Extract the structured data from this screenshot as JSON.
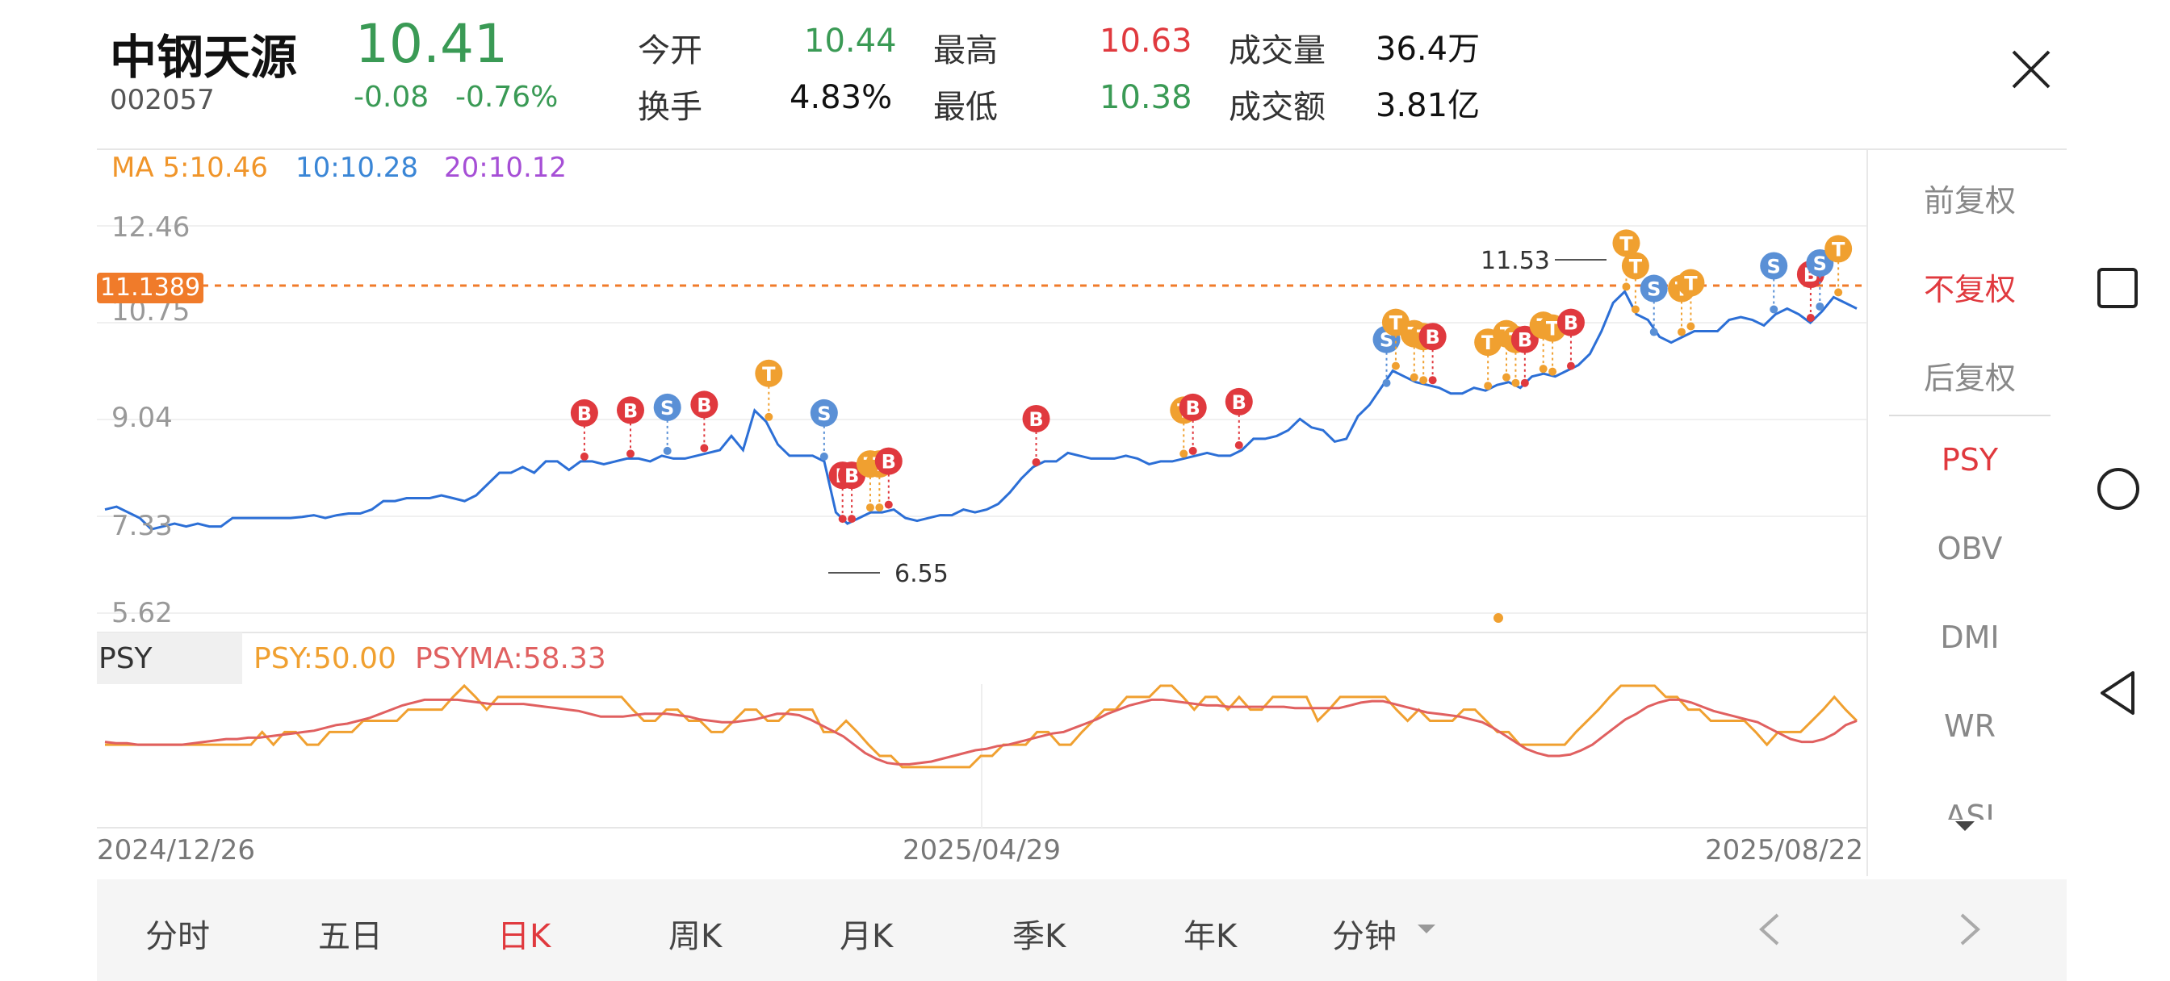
{
  "header": {
    "stock_name": "中钢天源",
    "stock_code": "002057",
    "last_price": "10.41",
    "change": "-0.08",
    "change_pct": "-0.76%",
    "quotes": [
      {
        "label": "今开",
        "value": "10.44",
        "color": "green"
      },
      {
        "label": "最高",
        "value": "10.63",
        "color": "red"
      },
      {
        "label": "成交量",
        "value": "36.4万",
        "color": "dark"
      },
      {
        "label": "换手",
        "value": "4.83%",
        "color": "dark"
      },
      {
        "label": "最低",
        "value": "10.38",
        "color": "green"
      },
      {
        "label": "成交额",
        "value": "3.81亿",
        "color": "dark"
      }
    ]
  },
  "ma_legend": {
    "ma5": "MA 5:10.46",
    "ma10": "10:10.28",
    "ma20": "20:10.12",
    "colors": {
      "ma5": "#f0952a",
      "ma10": "#3a86d6",
      "ma20": "#a64fd6"
    }
  },
  "main_chart": {
    "y_labels": [
      "12.46",
      "10.75",
      "9.04",
      "7.33",
      "5.62"
    ],
    "current_price_tag": "11.1389",
    "high_annotation": "11.53",
    "low_annotation": "6.55",
    "line_color": "#2c6fd6",
    "ref_line_color": "#f07b2a"
  },
  "chart_data": [
    {
      "type": "line",
      "title": "",
      "x": [
        "2024/12/26",
        "2025/04/29",
        "2025/08/22"
      ],
      "series": [
        {
          "name": "",
          "values": [
            7.45,
            7.5,
            7.4,
            7.3,
            7.1,
            7.15,
            7.2,
            7.15,
            7.2,
            7.15,
            7.15,
            7.3,
            7.3,
            7.3,
            7.3,
            7.3,
            7.3,
            7.32,
            7.35,
            7.3,
            7.35,
            7.38,
            7.38,
            7.45,
            7.6,
            7.6,
            7.65,
            7.65,
            7.65,
            7.7,
            7.65,
            7.6,
            7.7,
            7.9,
            8.1,
            8.1,
            8.2,
            8.1,
            8.3,
            8.3,
            8.15,
            8.3,
            8.3,
            8.25,
            8.3,
            8.35,
            8.35,
            8.3,
            8.4,
            8.35,
            8.35,
            8.4,
            8.45,
            8.5,
            8.75,
            8.5,
            9.2,
            9.0,
            8.6,
            8.4,
            8.4,
            8.4,
            8.3,
            7.4,
            7.2,
            7.3,
            7.4,
            7.4,
            7.45,
            7.3,
            7.25,
            7.3,
            7.35,
            7.35,
            7.45,
            7.4,
            7.45,
            7.55,
            7.75,
            8.0,
            8.2,
            8.3,
            8.3,
            8.45,
            8.4,
            8.35,
            8.35,
            8.35,
            8.4,
            8.35,
            8.25,
            8.3,
            8.3,
            8.35,
            8.4,
            8.45,
            8.4,
            8.4,
            8.5,
            8.7,
            8.7,
            8.75,
            8.85,
            9.05,
            8.9,
            8.85,
            8.65,
            8.7,
            9.1,
            9.3,
            9.6,
            9.9,
            9.8,
            9.7,
            9.65,
            9.6,
            9.5,
            9.5,
            9.6,
            9.55,
            9.65,
            9.7,
            9.6,
            9.8,
            9.85,
            9.8,
            9.9,
            10.0,
            10.2,
            10.6,
            11.1,
            11.3,
            10.9,
            10.8,
            10.5,
            10.4,
            10.5,
            10.6,
            10.6,
            10.6,
            10.8,
            10.85,
            10.8,
            10.7,
            10.9,
            11.0,
            10.9,
            10.75,
            10.95,
            11.2,
            11.1,
            11.0
          ]
        }
      ]
    },
    {
      "type": "line",
      "title": "",
      "series": [
        {
          "name": "PSY",
          "values": [
            58,
            58,
            58,
            58,
            58,
            58,
            58,
            58,
            58,
            58,
            58,
            58,
            58,
            58,
            67,
            58,
            67,
            67,
            58,
            58,
            67,
            67,
            67,
            75,
            75,
            75,
            75,
            83,
            83,
            83,
            83,
            92,
            100,
            92,
            83,
            92,
            92,
            92,
            92,
            92,
            92,
            92,
            92,
            92,
            92,
            92,
            92,
            83,
            75,
            75,
            83,
            83,
            75,
            75,
            67,
            67,
            75,
            83,
            83,
            75,
            75,
            83,
            83,
            83,
            67,
            67,
            75,
            67,
            58,
            50,
            50,
            42,
            42,
            42,
            42,
            42,
            42,
            42,
            50,
            50,
            58,
            58,
            58,
            67,
            67,
            58,
            58,
            67,
            75,
            83,
            83,
            92,
            92,
            92,
            100,
            100,
            92,
            83,
            92,
            92,
            83,
            92,
            83,
            83,
            92,
            92,
            92,
            92,
            75,
            83,
            92,
            92,
            92,
            92,
            92,
            83,
            75,
            83,
            75,
            75,
            75,
            83,
            83,
            75,
            67,
            67,
            58,
            58,
            58,
            58,
            58,
            67,
            75,
            83,
            92,
            100,
            100,
            100,
            100,
            92,
            92,
            83,
            83,
            75,
            75,
            75,
            75,
            67,
            58,
            67,
            67,
            67,
            75,
            83,
            92,
            83,
            75
          ]
        },
        {
          "name": "PSYMA",
          "values": [
            60,
            59,
            59,
            58,
            58,
            58,
            58,
            58,
            59,
            60,
            61,
            62,
            62,
            63,
            63,
            64,
            65,
            66,
            67,
            68,
            70,
            72,
            73,
            75,
            77,
            80,
            83,
            86,
            88,
            90,
            90,
            90,
            90,
            89,
            88,
            87,
            87,
            87,
            87,
            86,
            85,
            84,
            83,
            82,
            80,
            78,
            78,
            78,
            79,
            80,
            80,
            80,
            79,
            78,
            76,
            75,
            74,
            74,
            75,
            76,
            78,
            80,
            80,
            79,
            76,
            72,
            68,
            64,
            58,
            52,
            48,
            45,
            44,
            44,
            45,
            46,
            48,
            50,
            52,
            54,
            55,
            57,
            58,
            60,
            62,
            64,
            66,
            67,
            70,
            73,
            76,
            80,
            83,
            86,
            88,
            90,
            90,
            89,
            88,
            87,
            86,
            86,
            85,
            85,
            85,
            85,
            85,
            85,
            84,
            84,
            84,
            84,
            84,
            86,
            88,
            89,
            89,
            87,
            85,
            83,
            81,
            80,
            79,
            78,
            76,
            74,
            70,
            65,
            60,
            55,
            52,
            50,
            50,
            51,
            54,
            58,
            64,
            70,
            76,
            80,
            85,
            88,
            90,
            90,
            88,
            85,
            82,
            80,
            78,
            76,
            74,
            70,
            66,
            62,
            60,
            60,
            62,
            66,
            72,
            75
          ]
        }
      ],
      "ylim": [
        0,
        100
      ]
    }
  ],
  "psy": {
    "label": "PSY",
    "psy_value": "PSY:50.00",
    "psyma_value": "PSYMA:58.33",
    "psy_color": "#f0a030",
    "psyma_color": "#e06060"
  },
  "dates": [
    "2024/12/26",
    "2025/04/29",
    "2025/08/22"
  ],
  "side_menu": [
    {
      "label": "前复权",
      "active": false
    },
    {
      "label": "不复权",
      "active": true
    },
    {
      "label": "后复权",
      "active": false
    },
    {
      "label": "PSY",
      "active": true
    },
    {
      "label": "OBV",
      "active": false
    },
    {
      "label": "DMI",
      "active": false
    },
    {
      "label": "WR",
      "active": false
    },
    {
      "label": "ASI",
      "active": false
    }
  ],
  "tabs": [
    {
      "label": "分时"
    },
    {
      "label": "五日"
    },
    {
      "label": "日K"
    },
    {
      "label": "周K"
    },
    {
      "label": "月K"
    },
    {
      "label": "季K"
    },
    {
      "label": "年K"
    },
    {
      "label": "分钟"
    }
  ],
  "icons": {
    "close": "close-icon",
    "prev": "chevron-left-icon",
    "next": "chevron-right-icon",
    "recent": "square-icon",
    "home": "circle-icon",
    "back": "triangle-back-icon"
  },
  "markers": [
    {
      "t": "B"
    },
    {
      "t": "S"
    },
    {
      "t": "T"
    }
  ]
}
